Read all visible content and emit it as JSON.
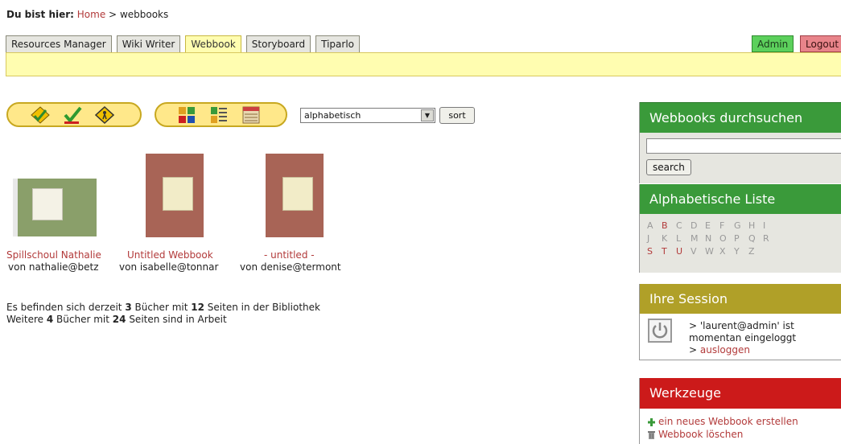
{
  "breadcrumb": {
    "label": "Du bist hier:",
    "home": "Home",
    "separator": ">",
    "current": "webbooks"
  },
  "tabs": [
    {
      "label": "Resources Manager"
    },
    {
      "label": "Wiki Writer"
    },
    {
      "label": "Webbook",
      "active": true
    },
    {
      "label": "Storyboard"
    },
    {
      "label": "Tiparlo"
    }
  ],
  "admin_tab": "Admin",
  "logout_tab": "Logout",
  "filter_icons": [
    "edit-check-icon",
    "approved-check-icon",
    "warning-sign-icon"
  ],
  "view_icons": [
    "grid-view-icon",
    "list-view-icon",
    "calendar-view-icon"
  ],
  "sort": {
    "selected": "alphabetisch",
    "button": "sort"
  },
  "books": [
    {
      "title": "Spillschoul Nathalie",
      "author": "von nathalie@betz",
      "cover": "green"
    },
    {
      "title": "Untitled Webbook",
      "author": "von isabelle@tonnar",
      "cover": "brown"
    },
    {
      "title": "- untitled -",
      "author": "von denise@termont",
      "cover": "brown"
    }
  ],
  "stats": {
    "line1_a": "Es befinden sich derzeit",
    "books_count": "3",
    "line1_b": "Bücher mit",
    "pages_count": "12",
    "line1_c": "Seiten in der Bibliothek",
    "line2_a": "Weitere",
    "wip_books": "4",
    "line2_b": "Bücher mit",
    "wip_pages": "24",
    "line2_c": "Seiten sind in Arbeit"
  },
  "search_panel": {
    "title": "Webbooks durchsuchen",
    "input_value": "",
    "button": "search"
  },
  "alpha_panel": {
    "title": "Alphabetische Liste",
    "letters": [
      {
        "l": "A",
        "on": false
      },
      {
        "l": "B",
        "on": true
      },
      {
        "l": "C",
        "on": false
      },
      {
        "l": "D",
        "on": false
      },
      {
        "l": "E",
        "on": false
      },
      {
        "l": "F",
        "on": false
      },
      {
        "l": "G",
        "on": false
      },
      {
        "l": "H",
        "on": false
      },
      {
        "l": "I",
        "on": false
      },
      {
        "l": "J",
        "on": false
      },
      {
        "l": "K",
        "on": false
      },
      {
        "l": "L",
        "on": false
      },
      {
        "l": "M",
        "on": false
      },
      {
        "l": "N",
        "on": false
      },
      {
        "l": "O",
        "on": false
      },
      {
        "l": "P",
        "on": false
      },
      {
        "l": "Q",
        "on": false
      },
      {
        "l": "R",
        "on": false
      },
      {
        "l": "S",
        "on": true
      },
      {
        "l": "T",
        "on": true
      },
      {
        "l": "U",
        "on": true
      },
      {
        "l": "V",
        "on": false
      },
      {
        "l": "W",
        "on": false
      },
      {
        "l": "X",
        "on": false
      },
      {
        "l": "Y",
        "on": false
      },
      {
        "l": "Z",
        "on": false
      }
    ]
  },
  "session_panel": {
    "title": "Ihre Session",
    "line1": "> 'laurent@admin' ist",
    "line2": "momentan eingeloggt",
    "logout_prefix": ">",
    "logout_link": "ausloggen"
  },
  "tools_panel": {
    "title": "Werkzeuge",
    "items": [
      {
        "label": "ein neues Webbook erstellen",
        "icon": "plus-icon"
      },
      {
        "label": "Webbook löschen",
        "icon": "trash-icon"
      }
    ]
  },
  "colors": {
    "link": "#b23a3a",
    "green_panel": "#3a9a3a",
    "session_panel": "#b0a028",
    "tools_panel": "#cc1a1a",
    "yellow_bar": "#fffdb0"
  }
}
